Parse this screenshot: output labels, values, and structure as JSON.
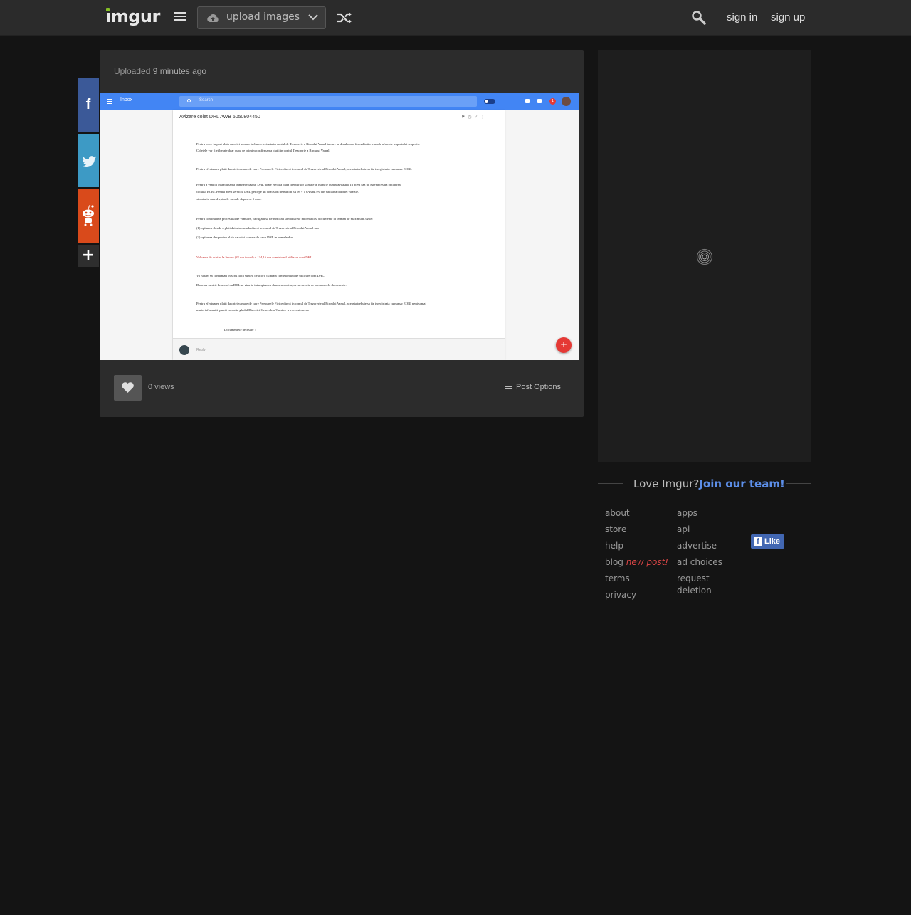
{
  "header": {
    "logo_text": "imgur",
    "upload_label": "upload images",
    "sign_in": "sign in",
    "sign_up": "sign up"
  },
  "icons": {
    "menu": "menu-icon",
    "upload": "cloud-upload-icon",
    "dropdown": "chevron-down-icon",
    "random": "shuffle-icon",
    "search": "search-icon",
    "facebook": "facebook-icon",
    "twitter": "twitter-icon",
    "reddit": "reddit-icon",
    "more": "plus-icon",
    "like": "heart-icon",
    "options": "list-icon",
    "loading": "spinner-icon"
  },
  "colors": {
    "brand_green": "#85bf25",
    "facebook": "#3b5998",
    "twitter": "#3d9ac5",
    "reddit": "#d94a1b",
    "join_link": "#5c8ee8",
    "new_post": "#d94545"
  },
  "post": {
    "uploaded_label": "Uploaded",
    "uploaded_time": "9 minutes ago",
    "views": "0 views",
    "options_label": "Post Options",
    "image": {
      "app_title": "Inbox",
      "search_placeholder": "Search",
      "subject": "Avizare colet DHL AWB 5050804450",
      "badge": "1",
      "reply_label": "Reply",
      "fab": "+",
      "lines": [
        "Pentru orice import plata datoriei vamale trebuie efectuata in contul de Trezorerie a Biroului Vamal in care se derulaeaza formalitatile vamale aferente importului respectiv",
        "Coletele vor fi eliberate doar dupa ce primim confirmarea platii in contul Trezorerie a Biroului Vamal.",
        "Pentru efectuarea platii datoriei vamale de catre Persoanele Fizice direct in contul de Trezorerie al Biroului Vamal, aceasta trebuie sa fie inregistrata cu numar EORI.",
        "Pentru a veni in intampinarea dumneavoastra, DHL poate efectua plata drepturilor vamale in numele dumneavoastra. In acest caz nu este necesara obtinerea",
        "codului EORI. Pentru acest serviciu DHL percepe un comision de minim 34 lei + TVA sau 3% din valoarea datoriei vamale.",
        "situatia in care drepturile vamale depasesc 5 euro.",
        "Pentru continuarea procesului de vamuire, va rugam sa ne furnizati urmatoarele informatii si documente in termen de maximum 3 zile:",
        "(1)        optiunea dvs de a plati datoria vamala direct in contul de Trezorerie al Biroului Vamal sau",
        "(2)        optiunea dvs pentru plata datoriei vamale de catre DHL in numele dvs.",
        "Valoarea de achitat la livrare (82 ron tva-ul) + 134,16 ron comisionul utilizare cont DHL",
        "Va rugam sa confirmati in scris daca sunteti de acord cu plata comisionului de utilizare cont DHL.",
        "Daca nu sunteti de acord cu DHL sa vina in intampinarea dumneavoastra, avem nevoie de urmatoarele documente:",
        "Pentru efectuarea platii datoriei vamale de catre Persoanele Fizice direct in contul de Trezorerie al Biroului Vamal, aceasta trebuie sa fie inregistrata cu numar EORI pentru mai",
        "multe informatii, puteti consulta ghidul Directiei Generale a Vamilor www.customs.ro",
        "Documentele necesare :"
      ]
    }
  },
  "sidebar": {
    "love_text": "Love Imgur?",
    "join_text": "Join our team!",
    "links_col1": [
      "about",
      "store",
      "help",
      "blog",
      "terms",
      "privacy"
    ],
    "blog_badge": "new post!",
    "links_col2": [
      "apps",
      "api",
      "advertise",
      "ad choices",
      "request deletion"
    ],
    "fb_like": "Like"
  }
}
